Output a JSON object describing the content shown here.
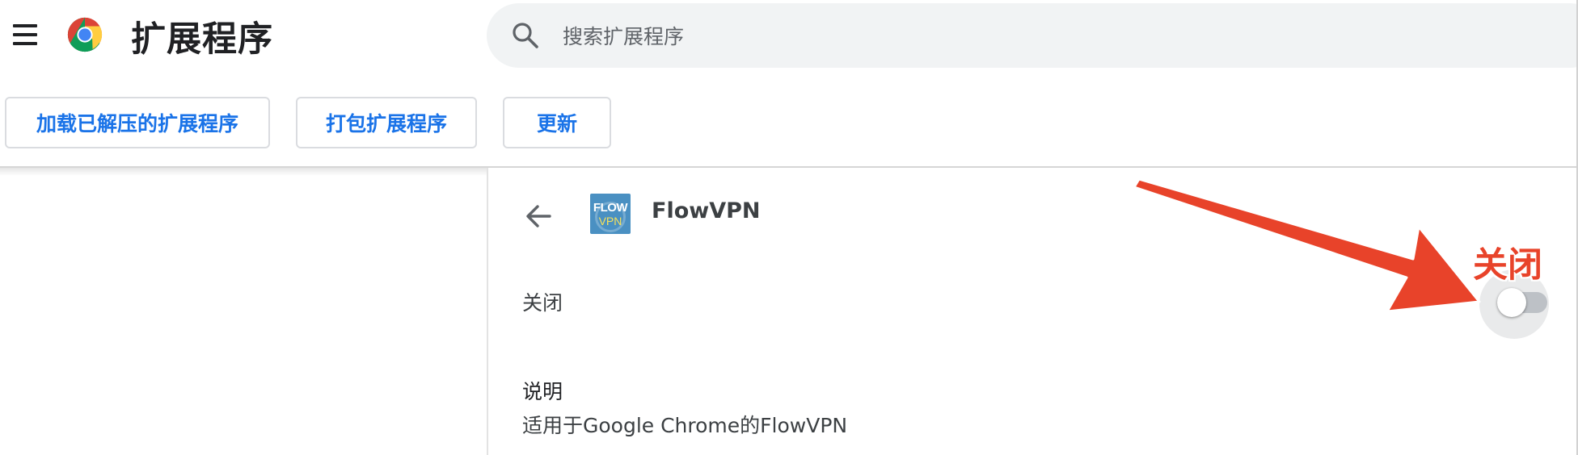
{
  "header": {
    "title": "扩展程序",
    "search": {
      "placeholder": "搜索扩展程序",
      "value": ""
    }
  },
  "toolbar": {
    "load_unpacked_label": "加载已解压的扩展程序",
    "pack_label": "打包扩展程序",
    "update_label": "更新"
  },
  "detail": {
    "extension_name": "FlowVPN",
    "icon_text_top": "FLOW",
    "icon_text_bottom": "VPN",
    "status_label": "关闭",
    "enabled": false,
    "description_heading": "说明",
    "description_text": "适用于Google Chrome的FlowVPN"
  },
  "annotation": {
    "text": "关闭",
    "color": "#e8432a"
  },
  "colors": {
    "accent": "#1a73e8",
    "toggle_off_track": "#bdc1c6",
    "search_bg": "#f1f3f4"
  },
  "icons": {
    "menu": "hamburger-menu-icon",
    "logo": "chrome-logo-icon",
    "search": "search-icon",
    "back": "arrow-back-icon"
  }
}
